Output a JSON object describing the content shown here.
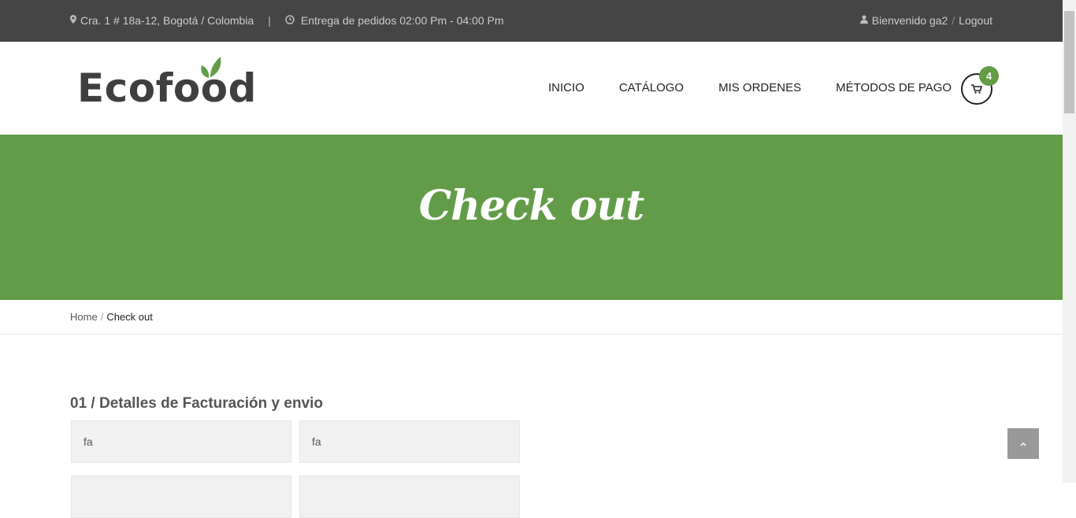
{
  "topbar": {
    "address": "Cra. 1 # 18a-12, Bogotá / Colombia",
    "separator": "|",
    "delivery": "Entrega de pedidos 02:00 Pm - 04:00 Pm",
    "welcome": "Bienvenido ga2",
    "slash": "/",
    "logout": "Logout"
  },
  "header": {
    "logo": "Ecofood",
    "nav": [
      "INICIO",
      "CATÁLOGO",
      "MIS ORDENES",
      "MÉTODOS DE PAGO"
    ],
    "cart_count": "4"
  },
  "banner": {
    "title": "Check out"
  },
  "breadcrumb": {
    "home": "Home",
    "slash": "/",
    "current": "Check out"
  },
  "section": {
    "title": "01 / Detalles de Facturación y envio",
    "fields": [
      {
        "value": "fa"
      },
      {
        "value": "fa"
      }
    ]
  },
  "colors": {
    "accent": "#629c48",
    "topbar": "#454545"
  },
  "icons": [
    "map-marker-icon",
    "clock-icon",
    "user-icon",
    "cart-icon",
    "chevron-up-icon"
  ]
}
